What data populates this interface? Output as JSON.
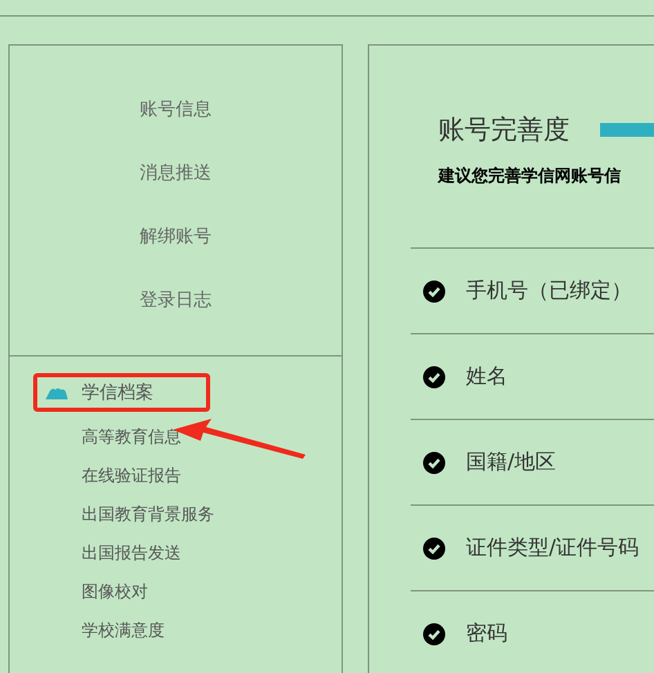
{
  "account_menu": [
    "账号信息",
    "消息推送",
    "解绑账号",
    "登录日志"
  ],
  "archive_section": {
    "heading": "学信档案",
    "highlighted": true,
    "items": [
      "高等教育信息",
      "在线验证报告",
      "出国教育背景服务",
      "出国报告发送",
      "图像校对",
      "学校满意度"
    ]
  },
  "completeness": {
    "title": "账号完善度",
    "subtitle": "建议您完善学信网账号信",
    "rows": [
      {
        "label": "手机号（已绑定）",
        "done": true
      },
      {
        "label": "姓名",
        "done": true
      },
      {
        "label": "国籍/地区",
        "done": true
      },
      {
        "label": "证件类型/证件号码",
        "done": true
      },
      {
        "label": "密码",
        "done": true
      }
    ]
  }
}
